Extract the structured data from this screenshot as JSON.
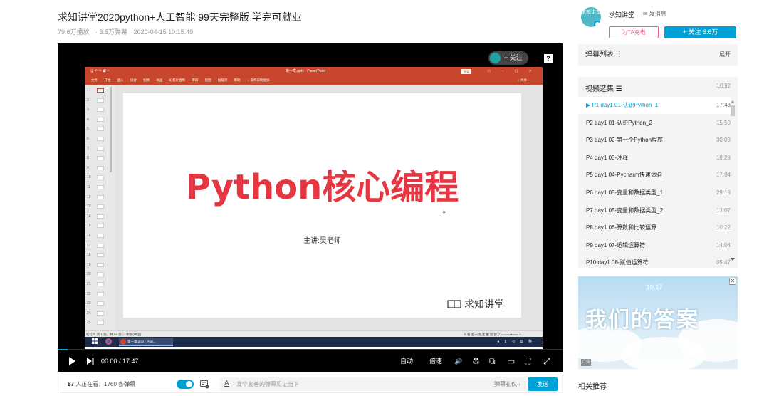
{
  "video": {
    "title": "求知讲堂2020python+人工智能 99天完整版 学完可就业",
    "plays": "79.6万播放",
    "danmaku": "· 3.5万弹幕",
    "date": "2020-04-15 10:15:49"
  },
  "overlay": {
    "follow_label": "+ 关注",
    "help_label": "?"
  },
  "ppt": {
    "qat": "🖫 ↶ ↷ 📽 ▾",
    "file_name": "第一章.pptx - PowerPoint",
    "login_label": "登录",
    "window_controls": "▭ – ▢ ✕",
    "ribbon_tabs": [
      "文件",
      "开始",
      "插入",
      "设计",
      "切换",
      "动画",
      "幻灯片放映",
      "审阅",
      "视图",
      "加载项",
      "帮助",
      "♀ 操作说明搜索"
    ],
    "share_label": "♀ 共享",
    "slide_numbers": [
      "1",
      "2",
      "3",
      "4",
      "5",
      "6",
      "7",
      "8",
      "9",
      "10",
      "11",
      "12",
      "13",
      "14",
      "15",
      "16",
      "17",
      "18",
      "19",
      "20",
      "21",
      "22",
      "23",
      "24",
      "25"
    ],
    "status_left": "幻灯片 第 1 张，共 54 张   ☐   中文(中国)",
    "status_right": "≙ 备注  ▬ 批注    ▦   ▥   ▤   ▽   –  ——●——  +",
    "taskbar_app": "第一章.pptx - Pow...",
    "tray": "● ⌷ ◁ ⚄ 英"
  },
  "slide": {
    "title": "Python核心编程",
    "subtitle": "主讲:吴老师",
    "logo_text": "求知讲堂"
  },
  "controls": {
    "time": "00:00 / 17:47",
    "auto_label": "自动",
    "speed_label": "倍速",
    "volume_icon": "🔊",
    "settings_icon": "⚙",
    "pip_icon": "⧉",
    "widescreen_icon": "▭",
    "webfullscreen_icon": "⛶",
    "fullscreen_icon": "⤢"
  },
  "sendbar": {
    "viewers_count": "87",
    "viewers_label": " 人正在看，",
    "danmaku_count": "1760",
    "danmaku_label": " 条弹幕",
    "toggle_label": "弹",
    "input_placeholder": "发个友善的弹幕见证当下",
    "gift_label": "弹幕礼仪 ›",
    "send_label": "发送"
  },
  "uploader": {
    "avatar_text": "求知讲堂",
    "name": "求知讲堂",
    "message_label": "✉ 发消息",
    "charge_label": "为TA充电",
    "follow_label": "+  关注 6.6万"
  },
  "danmaku_list": {
    "title": "弹幕列表  ⋮",
    "expand_label": "展开"
  },
  "episodes": {
    "title": "视频选集  ☰",
    "count": "1/192",
    "items": [
      {
        "label": "▶ P1  day1 01-认识Python_1",
        "duration": "17:48"
      },
      {
        "label": "P2  day1 01-认识Python_2",
        "duration": "15:50"
      },
      {
        "label": "P3  day1 02-第一个Python程序",
        "duration": "30:09"
      },
      {
        "label": "P4  day1 03-注释",
        "duration": "18:28"
      },
      {
        "label": "P5  day1 04-Pycharm快速体验",
        "duration": "17:04"
      },
      {
        "label": "P6  day1 05-变量和数据类型_1",
        "duration": "29:19"
      },
      {
        "label": "P7  day1 05-变量和数据类型_2",
        "duration": "13:07"
      },
      {
        "label": "P8  day1 06-算数和比较运算",
        "duration": "10:22"
      },
      {
        "label": "P9  day1 07-逻辑运算符",
        "duration": "14:04"
      },
      {
        "label": "P10  day1 08-赋值运算符",
        "duration": "05:47"
      }
    ]
  },
  "ad": {
    "date": "10.17",
    "headline": "我们的答案",
    "close_label": "✕",
    "tag": "广告"
  },
  "related_title": "相关推荐",
  "colors": {
    "accent": "#00a1d6",
    "pink": "#f25d8e",
    "ppt_red": "#c8462b",
    "slide_title": "#e53641"
  }
}
